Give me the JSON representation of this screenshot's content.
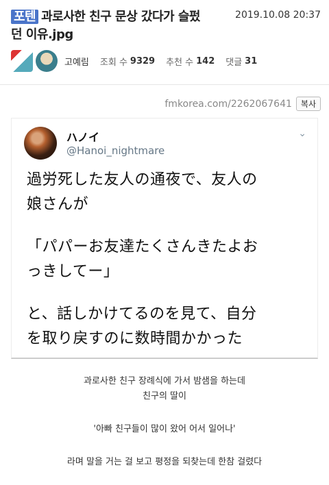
{
  "post": {
    "category": "포텐",
    "title_l1": "과로사한 친구 문상 갔다가 슬펐",
    "title_l2": "던 이유.jpg",
    "date": "2019.10.08 20:37"
  },
  "meta": {
    "author": "고예림",
    "views_label": "조회 수",
    "views": "9329",
    "likes_label": "추천 수",
    "likes": "142",
    "comments_label": "댓글",
    "comments": "31"
  },
  "source": {
    "url": "fmkorea.com/2262067641",
    "copy_label": "복사"
  },
  "tweet": {
    "name": "ハノイ",
    "handle": "@Hanoi_nightmare",
    "lines": [
      "過労死した友人の通夜で、友人の",
      "娘さんが",
      "「パパーお友達たくさんきたよお",
      "っきしてー」",
      "と、話しかけてるのを見て、自分",
      "を取り戻すのに数時間かかった"
    ]
  },
  "translation": {
    "line1": "과로사한 친구 장례식에 가서 밤샘을 하는데",
    "line2": "친구의 딸이",
    "line3": "'아빠 친구들이 많이 왔어 어서 일어나'",
    "line4": "라며 말을 거는 걸 보고 평정을 되찾는데 한참 걸렸다"
  }
}
